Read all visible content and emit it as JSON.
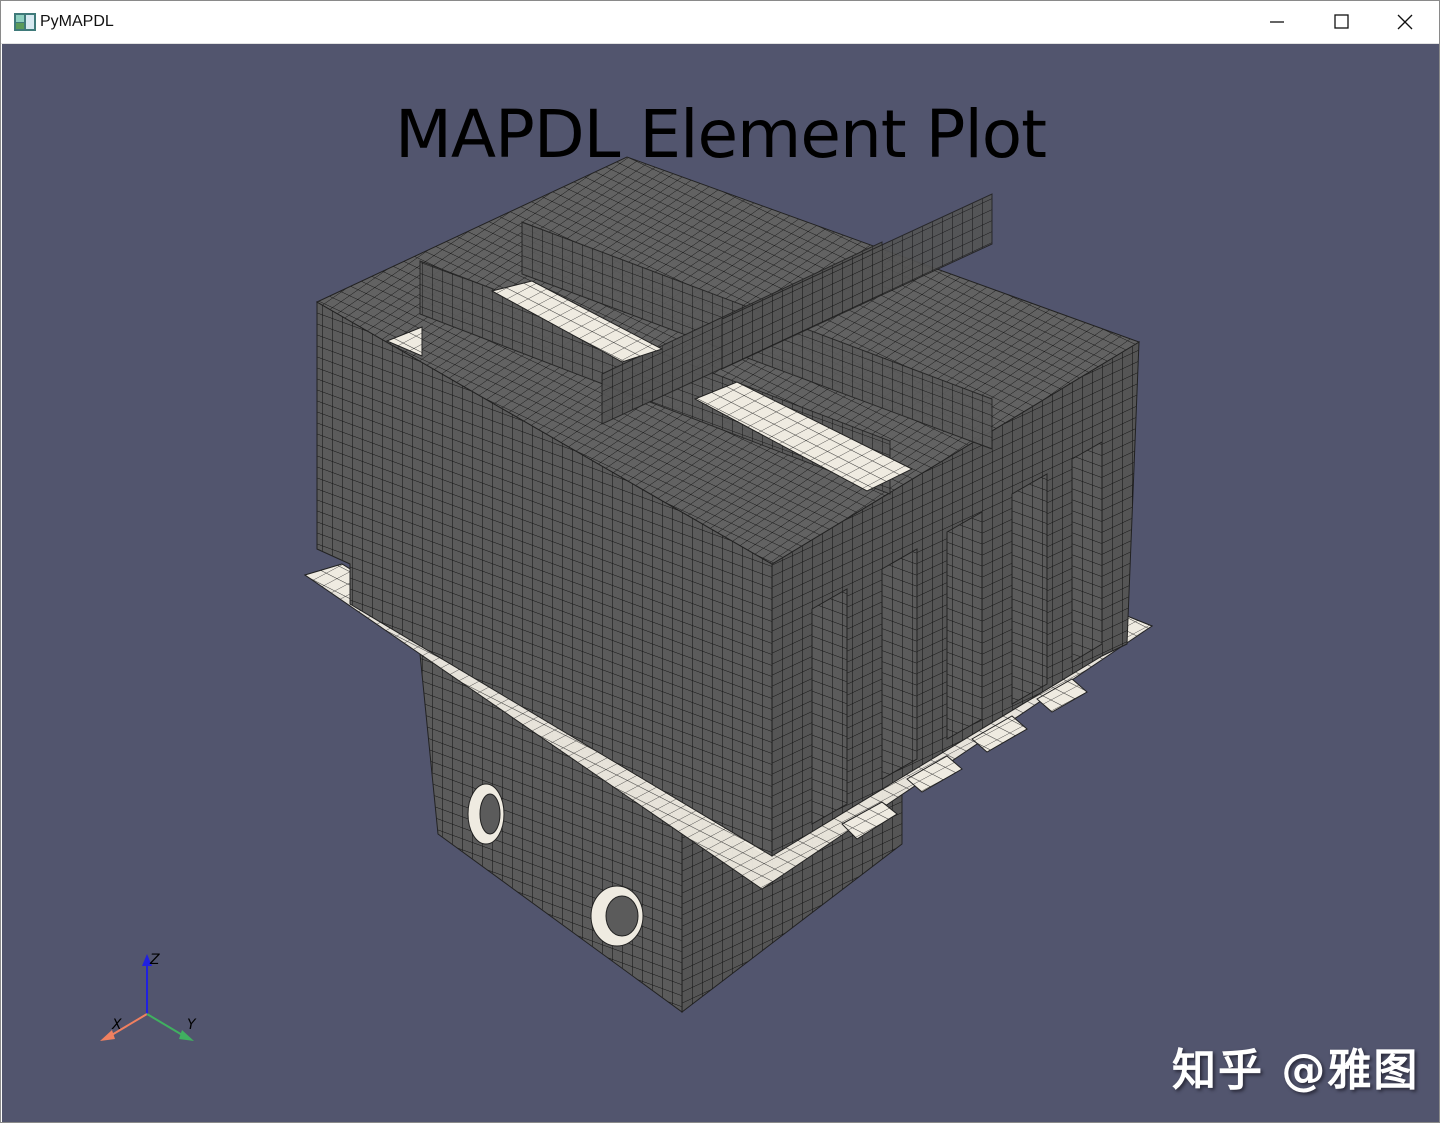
{
  "window": {
    "title": "PyMAPDL",
    "controls": {
      "minimize_icon": "minimize-icon",
      "maximize_icon": "maximize-icon",
      "close_icon": "close-icon"
    }
  },
  "viewport": {
    "background_color": "#52556e",
    "plot_title": "MAPDL Element Plot",
    "mesh_face_color": "#5a5a5a",
    "mesh_edge_color": "#000000",
    "plate_color": "#efebe1"
  },
  "axes_widget": {
    "x_label": "X",
    "y_label": "Y",
    "z_label": "Z",
    "x_color": "#f08060",
    "y_color": "#40b060",
    "z_color": "#2020e0"
  },
  "watermark": "知乎 @雅图"
}
